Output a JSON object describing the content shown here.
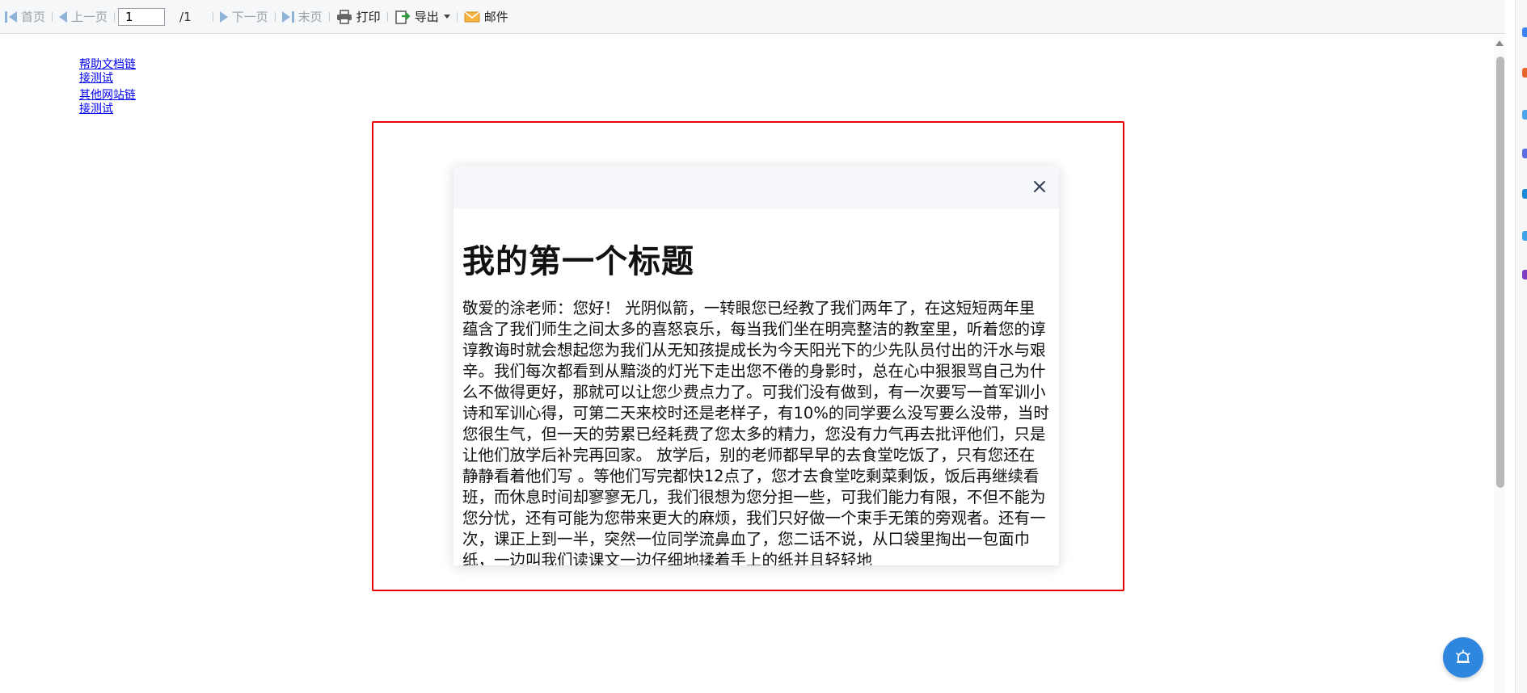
{
  "toolbar": {
    "first_label": "首页",
    "prev_label": "上一页",
    "page_value": "1",
    "page_total": "/1",
    "next_label": "下一页",
    "last_label": "末页",
    "print_label": "打印",
    "export_label": "导出",
    "mail_label": "邮件"
  },
  "links": [
    {
      "label": "帮助文档链接测试"
    },
    {
      "label": "其他网站链接测试"
    }
  ],
  "dialog": {
    "title": "我的第一个标题",
    "body": "敬爱的涂老师：您好！ 光阴似箭，一转眼您已经教了我们两年了，在这短短两年里蕴含了我们师生之间太多的喜怒哀乐，每当我们坐在明亮整洁的教室里，听着您的谆谆教诲时就会想起您为我们从无知孩提成长为今天阳光下的少先队员付出的汗水与艰辛。我们每次都看到从黯淡的灯光下走出您不倦的身影时，总在心中狠狠骂自己为什么不做得更好，那就可以让您少费点力了。可我们没有做到，有一次要写一首军训小诗和军训心得，可第二天来校时还是老样子，有10%的同学要么没写要么没带，当时您很生气，但一天的劳累已经耗费了您太多的精力，您没有力气再去批评他们，只是让他们放学后补完再回家。 放学后，别的老师都早早的去食堂吃饭了，只有您还在静静看着他们写 。等他们写完都快12点了，您才去食堂吃剩菜剩饭，饭后再继续看班，而休息时间却寥寥无几，我们很想为您分担一些，可我们能力有限，不但不能为您分忧，还有可能为您带来更大的麻烦，我们只好做一个束手无策的旁观者。还有一次，课正上到一半，突然一位同学流鼻血了，您二话不说，从口袋里掏出一包面巾纸，一边叫我们读课文一边仔细地揉着手上的纸并且轻轻地"
  },
  "colors": {
    "highlight": "#e60000",
    "accent": "#2e86de",
    "link": "#0000ee"
  },
  "icons": {
    "first": "first-page-icon",
    "prev": "prev-page-icon",
    "next": "next-page-icon",
    "last": "last-page-icon",
    "print": "printer-icon",
    "export": "export-icon",
    "mail": "mail-icon",
    "close": "close-icon",
    "fab": "alarm-icon"
  }
}
